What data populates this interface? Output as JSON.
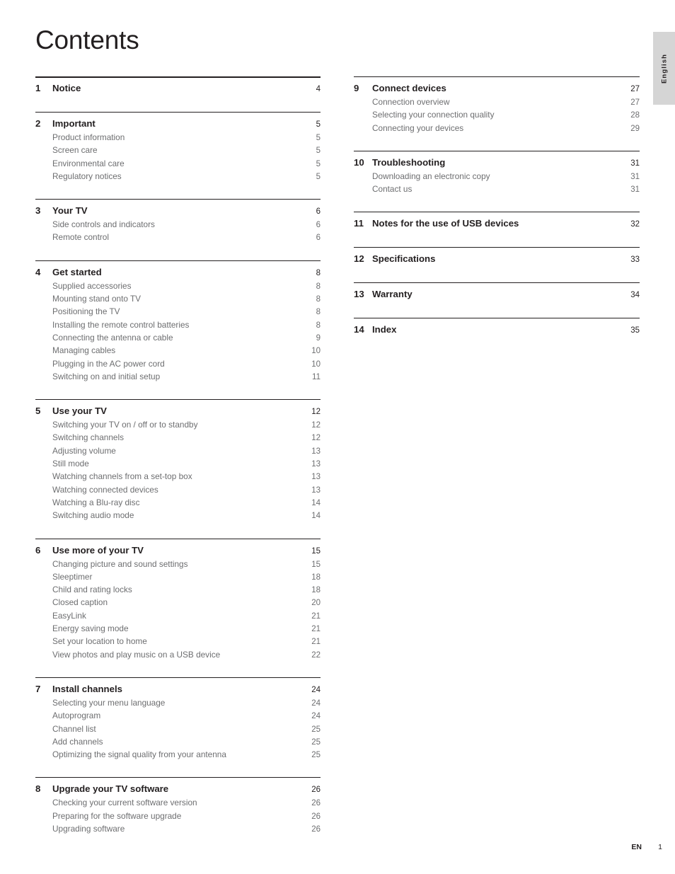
{
  "document": {
    "title": "Contents",
    "language_tab": "English",
    "footer": {
      "language_code": "EN",
      "page_number": "1"
    }
  },
  "toc": {
    "left_column": [
      {
        "number": "1",
        "title": "Notice",
        "page": "4",
        "rule": "heavy",
        "items": []
      },
      {
        "number": "2",
        "title": "Important",
        "page": "5",
        "rule": "thin",
        "items": [
          {
            "title": "Product information",
            "page": "5"
          },
          {
            "title": "Screen care",
            "page": "5"
          },
          {
            "title": "Environmental care",
            "page": "5"
          },
          {
            "title": "Regulatory notices",
            "page": "5"
          }
        ]
      },
      {
        "number": "3",
        "title": "Your TV",
        "page": "6",
        "rule": "thin",
        "items": [
          {
            "title": "Side controls and indicators",
            "page": "6"
          },
          {
            "title": "Remote control",
            "page": "6"
          }
        ]
      },
      {
        "number": "4",
        "title": "Get started",
        "page": "8",
        "rule": "thin",
        "items": [
          {
            "title": "Supplied accessories",
            "page": "8"
          },
          {
            "title": "Mounting stand onto TV",
            "page": "8"
          },
          {
            "title": "Positioning the TV",
            "page": "8"
          },
          {
            "title": "Installing the remote control batteries",
            "page": "8"
          },
          {
            "title": "Connecting the antenna or cable",
            "page": "9"
          },
          {
            "title": "Managing cables",
            "page": "10"
          },
          {
            "title": "Plugging in the AC power cord",
            "page": "10"
          },
          {
            "title": "Switching on and initial setup",
            "page": "11"
          }
        ]
      },
      {
        "number": "5",
        "title": "Use your TV",
        "page": "12",
        "rule": "thin",
        "items": [
          {
            "title": "Switching your TV on / off or to standby",
            "page": "12"
          },
          {
            "title": "Switching channels",
            "page": "12"
          },
          {
            "title": "Adjusting volume",
            "page": "13"
          },
          {
            "title": "Still mode",
            "page": "13"
          },
          {
            "title": "Watching channels from a set-top box",
            "page": "13"
          },
          {
            "title": "Watching connected devices",
            "page": "13"
          },
          {
            "title": "Watching a Blu-ray disc",
            "page": "14"
          },
          {
            "title": "Switching audio mode",
            "page": "14"
          }
        ]
      },
      {
        "number": "6",
        "title": "Use more of your TV",
        "page": "15",
        "rule": "thin",
        "items": [
          {
            "title": "Changing picture and sound settings",
            "page": "15"
          },
          {
            "title": "Sleeptimer",
            "page": "18"
          },
          {
            "title": "Child and rating locks",
            "page": "18"
          },
          {
            "title": "Closed caption",
            "page": "20"
          },
          {
            "title": "EasyLink",
            "page": "21"
          },
          {
            "title": "Energy saving mode",
            "page": "21"
          },
          {
            "title": "Set your location to home",
            "page": "21"
          },
          {
            "title": "View photos and play music on a USB device",
            "page": "22"
          }
        ]
      },
      {
        "number": "7",
        "title": "Install channels",
        "page": "24",
        "rule": "thin",
        "items": [
          {
            "title": "Selecting your menu language",
            "page": "24"
          },
          {
            "title": "Autoprogram",
            "page": "24"
          },
          {
            "title": "Channel list",
            "page": "25"
          },
          {
            "title": "Add channels",
            "page": "25"
          },
          {
            "title": "Optimizing the signal quality from your antenna",
            "page": "25"
          }
        ]
      },
      {
        "number": "8",
        "title": "Upgrade your TV software",
        "page": "26",
        "rule": "thin",
        "items": [
          {
            "title": "Checking your current software version",
            "page": "26"
          },
          {
            "title": "Preparing for the software upgrade",
            "page": "26"
          },
          {
            "title": "Upgrading software",
            "page": "26"
          }
        ]
      }
    ],
    "right_column": [
      {
        "number": "9",
        "title": "Connect devices",
        "page": "27",
        "rule": "thin",
        "items": [
          {
            "title": "Connection overview",
            "page": "27"
          },
          {
            "title": "Selecting your connection quality",
            "page": "28"
          },
          {
            "title": "Connecting your devices",
            "page": "29"
          }
        ]
      },
      {
        "number": "10",
        "title": "Troubleshooting",
        "page": "31",
        "rule": "thin",
        "items": [
          {
            "title": "Downloading an electronic copy",
            "page": "31"
          },
          {
            "title": "Contact us",
            "page": "31"
          }
        ]
      },
      {
        "number": "11",
        "title": "Notes for the use of USB devices",
        "page": "32",
        "rule": "thin",
        "items": []
      },
      {
        "number": "12",
        "title": "Specifications",
        "page": "33",
        "rule": "thin",
        "items": []
      },
      {
        "number": "13",
        "title": "Warranty",
        "page": "34",
        "rule": "thin",
        "items": []
      },
      {
        "number": "14",
        "title": "Index",
        "page": "35",
        "rule": "thin",
        "items": []
      }
    ]
  }
}
